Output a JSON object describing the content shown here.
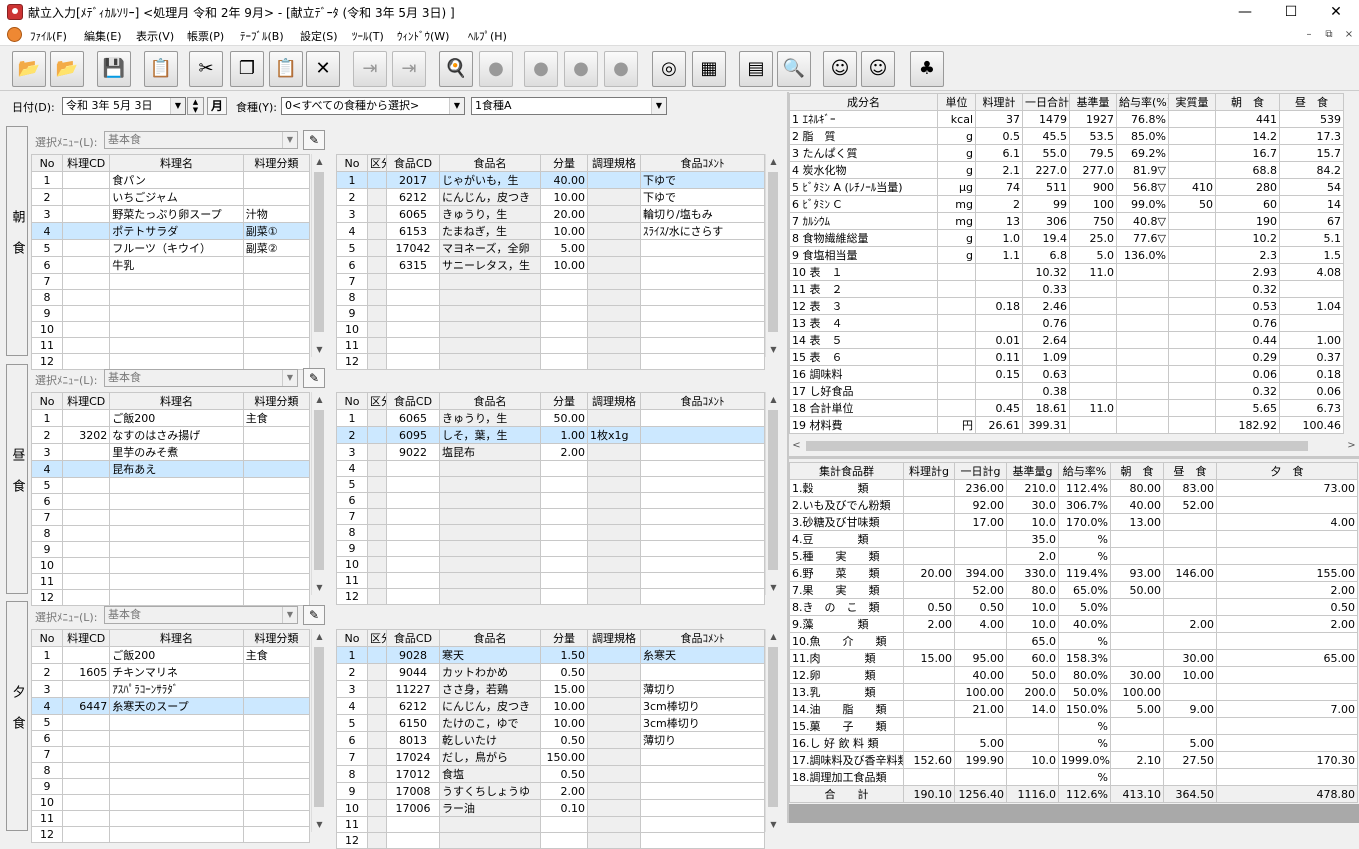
{
  "window": {
    "title": "献立入力[ﾒﾃﾞｨｶﾙｿﾘｰ] <処理月 令和 2年 9月> - [献立ﾃﾞｰﾀ (令和 3年 5月 3日) ]"
  },
  "menu": [
    "ﾌｧｲﾙ(F)",
    "編集(E)",
    "表示(V)",
    "帳票(P)",
    "ﾃｰﾌﾞﾙ(B)",
    "設定(S)",
    "ﾂｰﾙ(T)",
    "ｳｨﾝﾄﾞｳ(W)",
    "ﾍﾙﾌﾟ(H)"
  ],
  "toolbar": [
    "open-folder",
    "open-network",
    "save",
    "copy-doc",
    "cut",
    "copy",
    "paste",
    "delete",
    "import",
    "export",
    "food-cooking",
    "dish",
    "dish-2",
    "dish-3",
    "dish-4",
    "nutrition",
    "grid",
    "menu-calendar",
    "search-menu",
    "person",
    "people-123",
    "table-set"
  ],
  "header": {
    "date_label": "日付(D):",
    "date_value": "令和 3年 5月 3日",
    "month_btn": "月",
    "type_label": "食種(Y):",
    "type_select": "0<すべての食種から選択>",
    "type_value": "1食種A"
  },
  "meals": [
    {
      "label": "朝食",
      "menu_label": "選択ﾒﾆｭｰ(L):",
      "menu_value": "基本食",
      "dishes": [
        [
          "1",
          "",
          "食パン",
          ""
        ],
        [
          "2",
          "",
          "いちごジャム",
          ""
        ],
        [
          "3",
          "",
          "野菜たっぷり卵スープ",
          "汁物"
        ],
        [
          "4",
          "",
          "ポテトサラダ",
          "副菜①"
        ],
        [
          "5",
          "",
          "フルーツ（キウイ）",
          "副菜②"
        ],
        [
          "6",
          "",
          "牛乳",
          ""
        ],
        [
          "7",
          "",
          "",
          ""
        ],
        [
          "8",
          "",
          "",
          ""
        ],
        [
          "9",
          "",
          "",
          ""
        ],
        [
          "10",
          "",
          "",
          ""
        ],
        [
          "11",
          "",
          "",
          ""
        ],
        [
          "12",
          "",
          "",
          ""
        ]
      ],
      "dish_sel": 3,
      "foods": [
        [
          "1",
          "",
          "2017",
          "じゃがいも，生",
          "40.00",
          "",
          "下ゆで"
        ],
        [
          "2",
          "",
          "6212",
          "にんじん，皮つき",
          "10.00",
          "",
          "下ゆで"
        ],
        [
          "3",
          "",
          "6065",
          "きゅうり，生",
          "20.00",
          "",
          "輪切り/塩もみ"
        ],
        [
          "4",
          "",
          "6153",
          "たまねぎ，生",
          "10.00",
          "",
          "ｽﾗｲｽ/水にさらす"
        ],
        [
          "5",
          "",
          "17042",
          "マヨネーズ，全卵",
          "5.00",
          "",
          ""
        ],
        [
          "6",
          "",
          "6315",
          "サニーレタス，生",
          "10.00",
          "",
          ""
        ],
        [
          "7",
          "",
          "",
          "",
          "",
          "",
          ""
        ],
        [
          "8",
          "",
          "",
          "",
          "",
          "",
          ""
        ],
        [
          "9",
          "",
          "",
          "",
          "",
          "",
          ""
        ],
        [
          "10",
          "",
          "",
          "",
          "",
          "",
          ""
        ],
        [
          "11",
          "",
          "",
          "",
          "",
          "",
          ""
        ],
        [
          "12",
          "",
          "",
          "",
          "",
          "",
          ""
        ]
      ],
      "food_sel": 0
    },
    {
      "label": "昼食",
      "menu_label": "選択ﾒﾆｭｰ(L):",
      "menu_value": "基本食",
      "dishes": [
        [
          "1",
          "",
          "ご飯200",
          "主食"
        ],
        [
          "2",
          "3202",
          "なすのはさみ揚げ",
          ""
        ],
        [
          "3",
          "",
          "里芋のみそ煮",
          ""
        ],
        [
          "4",
          "",
          "昆布あえ",
          ""
        ],
        [
          "5",
          "",
          "",
          ""
        ],
        [
          "6",
          "",
          "",
          ""
        ],
        [
          "7",
          "",
          "",
          ""
        ],
        [
          "8",
          "",
          "",
          ""
        ],
        [
          "9",
          "",
          "",
          ""
        ],
        [
          "10",
          "",
          "",
          ""
        ],
        [
          "11",
          "",
          "",
          ""
        ],
        [
          "12",
          "",
          "",
          ""
        ]
      ],
      "dish_sel": 3,
      "foods": [
        [
          "1",
          "",
          "6065",
          "きゅうり，生",
          "50.00",
          "",
          ""
        ],
        [
          "2",
          "",
          "6095",
          "しそ，葉，生",
          "1.00",
          "1枚x1g",
          ""
        ],
        [
          "3",
          "",
          "9022",
          "塩昆布",
          "2.00",
          "",
          ""
        ],
        [
          "4",
          "",
          "",
          "",
          "",
          "",
          ""
        ],
        [
          "5",
          "",
          "",
          "",
          "",
          "",
          ""
        ],
        [
          "6",
          "",
          "",
          "",
          "",
          "",
          ""
        ],
        [
          "7",
          "",
          "",
          "",
          "",
          "",
          ""
        ],
        [
          "8",
          "",
          "",
          "",
          "",
          "",
          ""
        ],
        [
          "9",
          "",
          "",
          "",
          "",
          "",
          ""
        ],
        [
          "10",
          "",
          "",
          "",
          "",
          "",
          ""
        ],
        [
          "11",
          "",
          "",
          "",
          "",
          "",
          ""
        ],
        [
          "12",
          "",
          "",
          "",
          "",
          "",
          ""
        ]
      ],
      "food_sel": 1
    },
    {
      "label": "夕食",
      "menu_label": "選択ﾒﾆｭｰ(L):",
      "menu_value": "基本食",
      "dishes": [
        [
          "1",
          "",
          "ご飯200",
          "主食"
        ],
        [
          "2",
          "1605",
          "チキンマリネ",
          ""
        ],
        [
          "3",
          "",
          "ｱｽﾊﾟﾗｺｰﾝｻﾗﾀﾞ",
          ""
        ],
        [
          "4",
          "6447",
          "糸寒天のスープ",
          ""
        ],
        [
          "5",
          "",
          "",
          ""
        ],
        [
          "6",
          "",
          "",
          ""
        ],
        [
          "7",
          "",
          "",
          ""
        ],
        [
          "8",
          "",
          "",
          ""
        ],
        [
          "9",
          "",
          "",
          ""
        ],
        [
          "10",
          "",
          "",
          ""
        ],
        [
          "11",
          "",
          "",
          ""
        ],
        [
          "12",
          "",
          "",
          ""
        ]
      ],
      "dish_sel": 3,
      "foods": [
        [
          "1",
          "",
          "9028",
          "寒天",
          "1.50",
          "",
          "糸寒天"
        ],
        [
          "2",
          "",
          "9044",
          "カットわかめ",
          "0.50",
          "",
          ""
        ],
        [
          "3",
          "",
          "11227",
          "ささ身，若鶏",
          "15.00",
          "",
          "薄切り"
        ],
        [
          "4",
          "",
          "6212",
          "にんじん，皮つき",
          "10.00",
          "",
          "3cm棒切り"
        ],
        [
          "5",
          "",
          "6150",
          "たけのこ，ゆで",
          "10.00",
          "",
          "3cm棒切り"
        ],
        [
          "6",
          "",
          "8013",
          "乾しいたけ",
          "0.50",
          "",
          "薄切り"
        ],
        [
          "7",
          "",
          "17024",
          "だし，鳥がら",
          "150.00",
          "",
          ""
        ],
        [
          "8",
          "",
          "17012",
          "食塩",
          "0.50",
          "",
          ""
        ],
        [
          "9",
          "",
          "17008",
          "うすくちしょうゆ",
          "2.00",
          "",
          ""
        ],
        [
          "10",
          "",
          "17006",
          "ラー油",
          "0.10",
          "",
          ""
        ],
        [
          "11",
          "",
          "",
          "",
          "",
          "",
          ""
        ],
        [
          "12",
          "",
          "",
          "",
          "",
          "",
          ""
        ]
      ],
      "food_sel": 0
    }
  ],
  "dish_headers": [
    "No",
    "料理CD",
    "料理名",
    "料理分類"
  ],
  "food_headers": [
    "No",
    "区分",
    "食品CD",
    "食品名",
    "分量",
    "調理規格",
    "食品ｺﾒﾝﾄ"
  ],
  "nutrient_headers": [
    "成分名",
    "単位",
    "料理計",
    "一日合計",
    "基準量",
    "給与率(%)",
    "実質量",
    "朝　食",
    "昼　食"
  ],
  "nutrients": [
    [
      "1 ｴﾈﾙｷﾞｰ",
      "kcal",
      "37",
      "1479",
      "1927",
      "76.8%",
      "",
      "441",
      "539"
    ],
    [
      "2 脂　質",
      "g",
      "0.5",
      "45.5",
      "53.5",
      "85.0%",
      "",
      "14.2",
      "17.3"
    ],
    [
      "3 たんぱく質",
      "g",
      "6.1",
      "55.0",
      "79.5",
      "69.2%",
      "",
      "16.7",
      "15.7"
    ],
    [
      "4 炭水化物",
      "g",
      "2.1",
      "227.0",
      "277.0",
      "81.9▽",
      "",
      "68.8",
      "84.2"
    ],
    [
      "5 ﾋﾞﾀﾐﾝ A (ﾚﾁﾉｰﾙ当量)",
      "μg",
      "74",
      "511",
      "900",
      "56.8▽",
      "410",
      "280",
      "54"
    ],
    [
      "6 ﾋﾞﾀﾐﾝ C",
      "mg",
      "2",
      "99",
      "100",
      "99.0%",
      "50",
      "60",
      "14"
    ],
    [
      "7 ｶﾙｼｳﾑ",
      "mg",
      "13",
      "306",
      "750",
      "40.8▽",
      "",
      "190",
      "67"
    ],
    [
      "8 食物繊維総量",
      "g",
      "1.0",
      "19.4",
      "25.0",
      "77.6▽",
      "",
      "10.2",
      "5.1"
    ],
    [
      "9 食塩相当量",
      "g",
      "1.1",
      "6.8",
      "5.0",
      "136.0%",
      "",
      "2.3",
      "1.5"
    ],
    [
      "10 表　１",
      "",
      "",
      "10.32",
      "11.0",
      "",
      "",
      "2.93",
      "4.08"
    ],
    [
      "11 表　２",
      "",
      "",
      "0.33",
      "",
      "",
      "",
      "0.32",
      ""
    ],
    [
      "12 表　３",
      "",
      "0.18",
      "2.46",
      "",
      "",
      "",
      "0.53",
      "1.04"
    ],
    [
      "13 表　４",
      "",
      "",
      "0.76",
      "",
      "",
      "",
      "0.76",
      ""
    ],
    [
      "14 表　５",
      "",
      "0.01",
      "2.64",
      "",
      "",
      "",
      "0.44",
      "1.00"
    ],
    [
      "15 表　６",
      "",
      "0.11",
      "1.09",
      "",
      "",
      "",
      "0.29",
      "0.37"
    ],
    [
      "16 調味料",
      "",
      "0.15",
      "0.63",
      "",
      "",
      "",
      "0.06",
      "0.18"
    ],
    [
      "17 し好食品",
      "",
      "",
      "0.38",
      "",
      "",
      "",
      "0.32",
      "0.06"
    ],
    [
      "18 合計単位",
      "",
      "0.45",
      "18.61",
      "11.0",
      "",
      "",
      "5.65",
      "6.73"
    ],
    [
      "19 材料費",
      "円",
      "26.61",
      "399.31",
      "",
      "",
      "",
      "182.92",
      "100.46"
    ]
  ],
  "group_headers": [
    "集計食品群",
    "料理計g",
    "一日計g",
    "基準量g",
    "給与率%",
    "朝　食",
    "昼　食",
    "夕　食"
  ],
  "groups": [
    [
      "1.穀　　　　類",
      "",
      "236.00",
      "210.0",
      "112.4%",
      "80.00",
      "83.00",
      "73.00"
    ],
    [
      "2.いも及びでん粉類",
      "",
      "92.00",
      "30.0",
      "306.7%",
      "40.00",
      "52.00",
      ""
    ],
    [
      "3.砂糖及び甘味類",
      "",
      "17.00",
      "10.0",
      "170.0%",
      "13.00",
      "",
      "4.00"
    ],
    [
      "4.豆　　　　類",
      "",
      "",
      "35.0",
      "%",
      "",
      "",
      ""
    ],
    [
      "5.種　　実　　類",
      "",
      "",
      "2.0",
      "%",
      "",
      "",
      ""
    ],
    [
      "6.野　　菜　　類",
      "20.00",
      "394.00",
      "330.0",
      "119.4%",
      "93.00",
      "146.00",
      "155.00"
    ],
    [
      "7.果　　実　　類",
      "",
      "52.00",
      "80.0",
      "65.0%",
      "50.00",
      "",
      "2.00"
    ],
    [
      "8.き　の　こ　類",
      "0.50",
      "0.50",
      "10.0",
      "5.0%",
      "",
      "",
      "0.50"
    ],
    [
      "9.藻　　　　類",
      "2.00",
      "4.00",
      "10.0",
      "40.0%",
      "",
      "2.00",
      "2.00"
    ],
    [
      "10.魚　　介　　類",
      "",
      "",
      "65.0",
      "%",
      "",
      "",
      ""
    ],
    [
      "11.肉　　　　類",
      "15.00",
      "95.00",
      "60.0",
      "158.3%",
      "",
      "30.00",
      "65.00"
    ],
    [
      "12.卵　　　　類",
      "",
      "40.00",
      "50.0",
      "80.0%",
      "30.00",
      "10.00",
      ""
    ],
    [
      "13.乳　　　　類",
      "",
      "100.00",
      "200.0",
      "50.0%",
      "100.00",
      "",
      ""
    ],
    [
      "14.油　　脂　　類",
      "",
      "21.00",
      "14.0",
      "150.0%",
      "5.00",
      "9.00",
      "7.00"
    ],
    [
      "15.菓　　子　　類",
      "",
      "",
      "",
      "%",
      "",
      "",
      ""
    ],
    [
      "16.し 好 飲 料 類",
      "",
      "5.00",
      "",
      "%",
      "",
      "5.00",
      ""
    ],
    [
      "17.調味料及び香辛料類",
      "152.60",
      "199.90",
      "10.0",
      "1999.0%",
      "2.10",
      "27.50",
      "170.30"
    ],
    [
      "18.調理加工食品類",
      "",
      "",
      "",
      "%",
      "",
      "",
      ""
    ]
  ],
  "group_total": [
    "合　　計",
    "190.10",
    "1256.40",
    "1116.0",
    "112.6%",
    "413.10",
    "364.50",
    "478.80"
  ]
}
